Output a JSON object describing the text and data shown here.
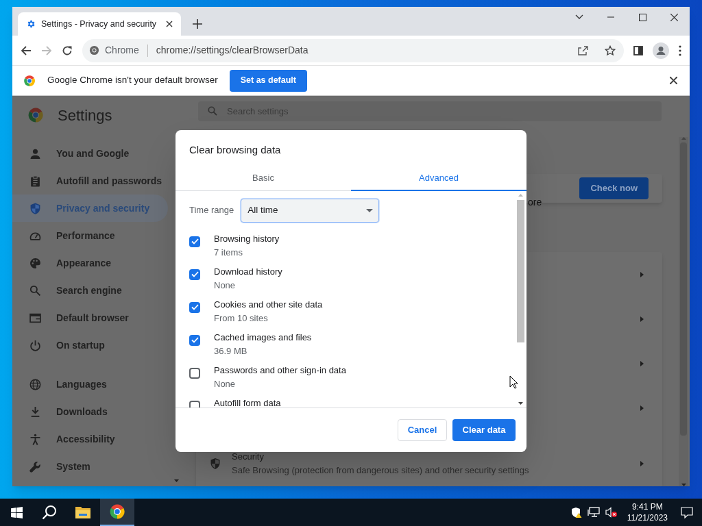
{
  "browser": {
    "tab": {
      "title": "Settings - Privacy and security",
      "selected": true
    },
    "address": {
      "site_label": "Chrome",
      "url": "chrome://settings/clearBrowserData"
    }
  },
  "infobar": {
    "message": "Google Chrome isn't your default browser",
    "button": "Set as default"
  },
  "settings": {
    "title": "Settings",
    "search_placeholder": "Search settings",
    "sidebar_groups": [
      [
        {
          "label": "You and Google",
          "selected": false
        },
        {
          "label": "Autofill and passwords",
          "selected": false
        },
        {
          "label": "Privacy and security",
          "selected": true
        },
        {
          "label": "Performance",
          "selected": false
        },
        {
          "label": "Appearance",
          "selected": false
        },
        {
          "label": "Search engine",
          "selected": false
        },
        {
          "label": "Default browser",
          "selected": false
        },
        {
          "label": "On startup",
          "selected": false
        }
      ],
      [
        {
          "label": "Languages",
          "selected": false
        },
        {
          "label": "Downloads",
          "selected": false
        },
        {
          "label": "Accessibility",
          "selected": false
        },
        {
          "label": "System",
          "selected": false
        }
      ]
    ],
    "safety_text_fragment": "ore",
    "check_button": "Check now",
    "security": {
      "title": "Security",
      "description": "Safe Browsing (protection from dangerous sites) and other security settings"
    }
  },
  "dialog": {
    "title": "Clear browsing data",
    "tabs": [
      {
        "label": "Basic",
        "selected": false
      },
      {
        "label": "Advanced",
        "selected": true
      }
    ],
    "time_range": {
      "label": "Time range",
      "value": "All time"
    },
    "items": [
      {
        "label": "Browsing history",
        "detail": "7 items",
        "checked": true
      },
      {
        "label": "Download history",
        "detail": "None",
        "checked": true
      },
      {
        "label": "Cookies and other site data",
        "detail": "From 10 sites",
        "checked": true
      },
      {
        "label": "Cached images and files",
        "detail": "36.9 MB",
        "checked": true
      },
      {
        "label": "Passwords and other sign-in data",
        "detail": "None",
        "checked": false
      },
      {
        "label": "Autofill form data",
        "checked": false
      }
    ],
    "buttons": {
      "cancel": "Cancel",
      "confirm": "Clear data"
    }
  },
  "taskbar": {
    "time": "9:41 PM",
    "date": "11/21/2023"
  }
}
